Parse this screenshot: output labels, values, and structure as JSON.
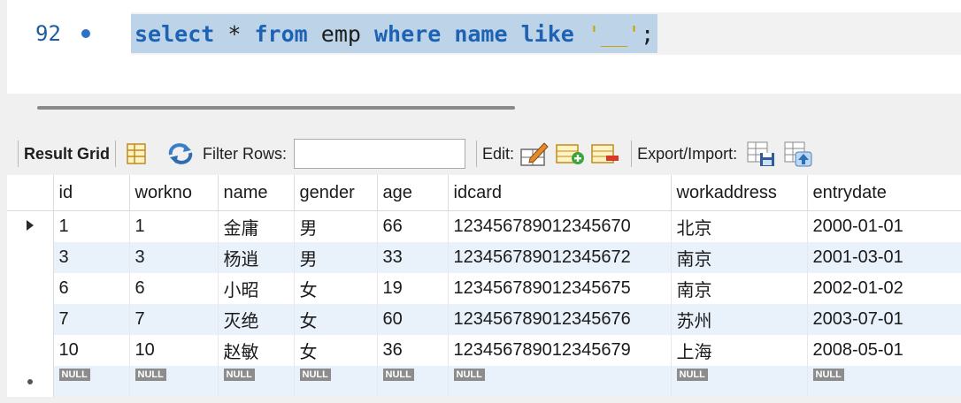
{
  "editor": {
    "line_number": "92",
    "tokens": [
      {
        "text": "select",
        "kind": "kw"
      },
      {
        "text": " ",
        "kind": "plain"
      },
      {
        "text": "*",
        "kind": "op"
      },
      {
        "text": " ",
        "kind": "plain"
      },
      {
        "text": "from",
        "kind": "kw"
      },
      {
        "text": " emp ",
        "kind": "plain"
      },
      {
        "text": "where",
        "kind": "kw"
      },
      {
        "text": " ",
        "kind": "plain"
      },
      {
        "text": "name",
        "kind": "kw"
      },
      {
        "text": " ",
        "kind": "plain"
      },
      {
        "text": "like",
        "kind": "kw"
      },
      {
        "text": " ",
        "kind": "plain"
      },
      {
        "text": "'__'",
        "kind": "str"
      },
      {
        "text": ";",
        "kind": "plain"
      }
    ]
  },
  "toolbar": {
    "result_grid_label": "Result Grid",
    "filter_rows_label": "Filter Rows:",
    "filter_value": "",
    "edit_label": "Edit:",
    "export_import_label": "Export/Import:"
  },
  "grid": {
    "columns": [
      "id",
      "workno",
      "name",
      "gender",
      "age",
      "idcard",
      "workaddress",
      "entrydate"
    ],
    "rows": [
      [
        "1",
        "1",
        "金庸",
        "男",
        "66",
        "123456789012345670",
        "北京",
        "2000-01-01"
      ],
      [
        "3",
        "3",
        "杨逍",
        "男",
        "33",
        "123456789012345672",
        "南京",
        "2001-03-01"
      ],
      [
        "6",
        "6",
        "小昭",
        "女",
        "19",
        "123456789012345675",
        "南京",
        "2002-01-02"
      ],
      [
        "7",
        "7",
        "灭绝",
        "女",
        "60",
        "123456789012345676",
        "苏州",
        "2003-07-01"
      ],
      [
        "10",
        "10",
        "赵敏",
        "女",
        "36",
        "123456789012345679",
        "上海",
        "2008-05-01"
      ]
    ],
    "null_label": "NULL"
  },
  "colors": {
    "keyword": "#1e62b4",
    "string": "#d0a000",
    "selection": "#bcd3e8",
    "row_alt": "#e9f1fb"
  }
}
